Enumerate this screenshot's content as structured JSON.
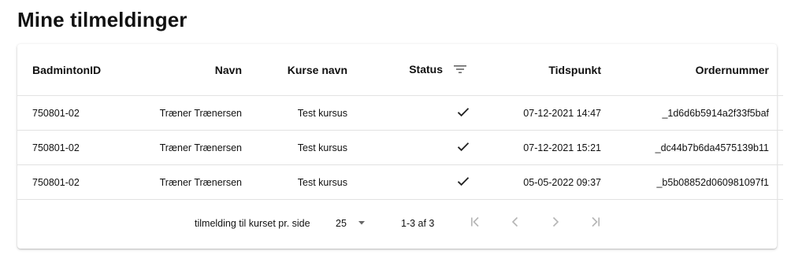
{
  "page": {
    "title": "Mine tilmeldinger"
  },
  "table": {
    "headers": {
      "badminton_id": "BadmintonID",
      "name": "Navn",
      "course": "Kurse navn",
      "status": "Status",
      "time": "Tidspunkt",
      "order": "Ordernummer"
    },
    "rows": [
      {
        "badminton_id": "750801-02",
        "name": "Træner Trænersen",
        "course": "Test kursus",
        "status_icon": "check-icon",
        "time": "07-12-2021 14:47",
        "order": "_1d6d6b5914a2f33f5baf"
      },
      {
        "badminton_id": "750801-02",
        "name": "Træner Trænersen",
        "course": "Test kursus",
        "status_icon": "check-icon",
        "time": "07-12-2021 15:21",
        "order": "_dc44b7b6da4575139b11"
      },
      {
        "badminton_id": "750801-02",
        "name": "Træner Trænersen",
        "course": "Test kursus",
        "status_icon": "check-icon",
        "time": "05-05-2022 09:37",
        "order": "_b5b08852d060981097f1"
      }
    ]
  },
  "pagination": {
    "rows_per_page_label": "tilmelding til kurset pr. side",
    "rows_per_page_value": "25",
    "range_text": "1-3 af 3",
    "icons": [
      "first-page-icon",
      "previous-page-icon",
      "next-page-icon",
      "last-page-icon"
    ]
  },
  "colors": {
    "text": "#111111",
    "muted_icon": "#b5b5b5",
    "divider": "#e2e2e2",
    "icon_dark": "#666666"
  }
}
